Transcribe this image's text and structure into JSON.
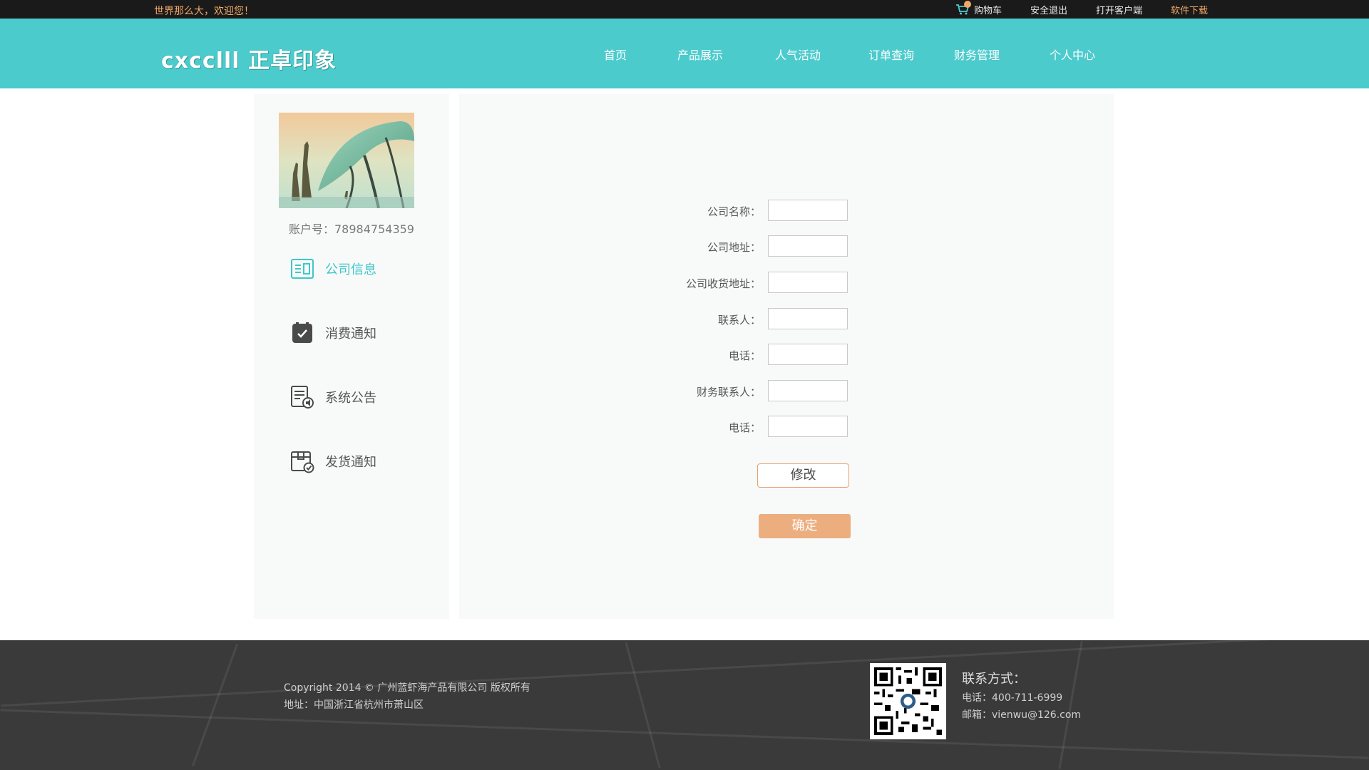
{
  "topbar": {
    "welcome": "世界那么大，欢迎您！",
    "cart_label": "购物车",
    "logout_label": "安全退出",
    "client_label": "打开客户端",
    "download_label": "软件下载"
  },
  "header": {
    "logo_text": "cxcclll 正卓印象",
    "nav": [
      "首页",
      "产品展示",
      "人气活动",
      "订单查询",
      "财务管理",
      "个人中心"
    ]
  },
  "sidebar": {
    "account": "账户号：78984754359",
    "items": [
      {
        "label": "公司信息",
        "icon": "company-info-icon",
        "active": true
      },
      {
        "label": "消费通知",
        "icon": "consumption-notice-icon",
        "active": false
      },
      {
        "label": "系统公告",
        "icon": "system-announcement-icon",
        "active": false
      },
      {
        "label": "发货通知",
        "icon": "shipping-notice-icon",
        "active": false
      }
    ]
  },
  "form": {
    "fields": [
      {
        "label": "公司名称：",
        "value": ""
      },
      {
        "label": "公司地址：",
        "value": ""
      },
      {
        "label": "公司收货地址：",
        "value": ""
      },
      {
        "label": "联系人：",
        "value": ""
      },
      {
        "label": "电话：",
        "value": ""
      },
      {
        "label": "财务联系人：",
        "value": ""
      },
      {
        "label": "电话：",
        "value": ""
      }
    ],
    "edit_label": "修改",
    "confirm_label": "确定"
  },
  "footer": {
    "copyright": "Copyright 2014 © 广州蓝虾海产品有限公司 版权所有",
    "address": "地址：中国浙江省杭州市萧山区",
    "contact_title": "联系方式：",
    "phone": "电话：400-711-6999",
    "email": "邮箱：vienwu@126.com"
  },
  "colors": {
    "header_bg": "#4ccbcd",
    "accent_orange": "#ecae7f",
    "active_teal": "#3ec7c9"
  }
}
